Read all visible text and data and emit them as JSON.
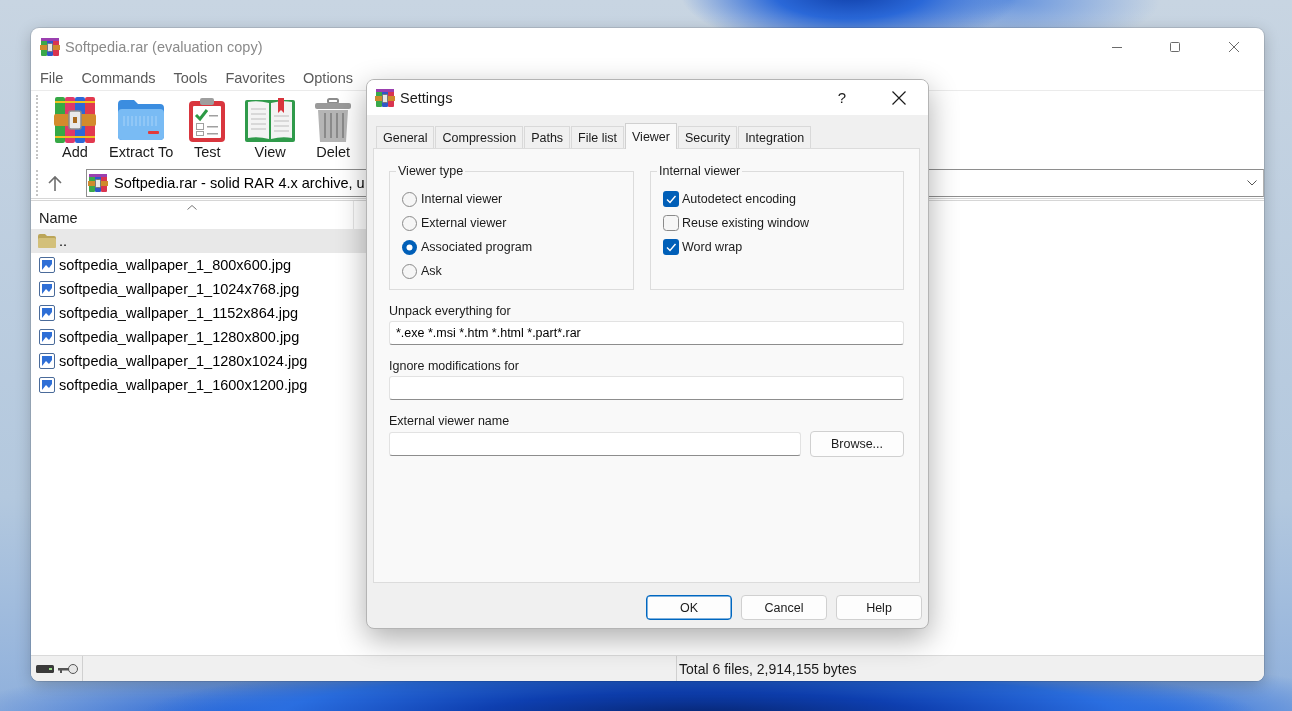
{
  "window": {
    "title": "Softpedia.rar (evaluation copy)"
  },
  "menu": [
    "File",
    "Commands",
    "Tools",
    "Favorites",
    "Options"
  ],
  "toolbar": [
    {
      "label": "Add"
    },
    {
      "label": "Extract To"
    },
    {
      "label": "Test"
    },
    {
      "label": "View"
    },
    {
      "label": "Delet"
    }
  ],
  "address_bar": {
    "text": "Softpedia.rar - solid RAR 4.x archive, u"
  },
  "file_list": {
    "columns": [
      {
        "label": "Name",
        "sorted": true
      }
    ],
    "rows": [
      {
        "name": "..",
        "kind": "folder",
        "selected": true
      },
      {
        "name": "softpedia_wallpaper_1_800x600.jpg",
        "kind": "image",
        "selected": false
      },
      {
        "name": "softpedia_wallpaper_1_1024x768.jpg",
        "kind": "image",
        "selected": false
      },
      {
        "name": "softpedia_wallpaper_1_1152x864.jpg",
        "kind": "image",
        "selected": false
      },
      {
        "name": "softpedia_wallpaper_1_1280x800.jpg",
        "kind": "image",
        "selected": false
      },
      {
        "name": "softpedia_wallpaper_1_1280x1024.jpg",
        "kind": "image",
        "selected": false
      },
      {
        "name": "softpedia_wallpaper_1_1600x1200.jpg",
        "kind": "image",
        "selected": false
      }
    ]
  },
  "status_bar": {
    "text": "Total 6 files, 2,914,155 bytes"
  },
  "dialog": {
    "title": "Settings",
    "help": "?",
    "tabs": [
      {
        "label": "General",
        "selected": false
      },
      {
        "label": "Compression",
        "selected": false
      },
      {
        "label": "Paths",
        "selected": false
      },
      {
        "label": "File list",
        "selected": false
      },
      {
        "label": "Viewer",
        "selected": true
      },
      {
        "label": "Security",
        "selected": false
      },
      {
        "label": "Integration",
        "selected": false
      }
    ],
    "viewer_type": {
      "legend": "Viewer type",
      "options": [
        {
          "label": "Internal viewer",
          "selected": false
        },
        {
          "label": "External viewer",
          "selected": false
        },
        {
          "label": "Associated program",
          "selected": true
        },
        {
          "label": "Ask",
          "selected": false
        }
      ]
    },
    "internal_viewer": {
      "legend": "Internal viewer",
      "options": [
        {
          "label": "Autodetect encoding",
          "checked": true
        },
        {
          "label": "Reuse existing window",
          "checked": false
        },
        {
          "label": "Word wrap",
          "checked": true
        }
      ]
    },
    "fields": [
      {
        "label": "Unpack everything for",
        "value": "*.exe *.msi *.htm *.html *.part*.rar"
      },
      {
        "label": "Ignore modifications for"
      },
      {
        "label": "External viewer name",
        "button": "Browse..."
      }
    ],
    "buttons": [
      {
        "label": "OK",
        "default": true
      },
      {
        "label": "Cancel",
        "default": false
      },
      {
        "label": "Help",
        "default": false
      }
    ]
  }
}
